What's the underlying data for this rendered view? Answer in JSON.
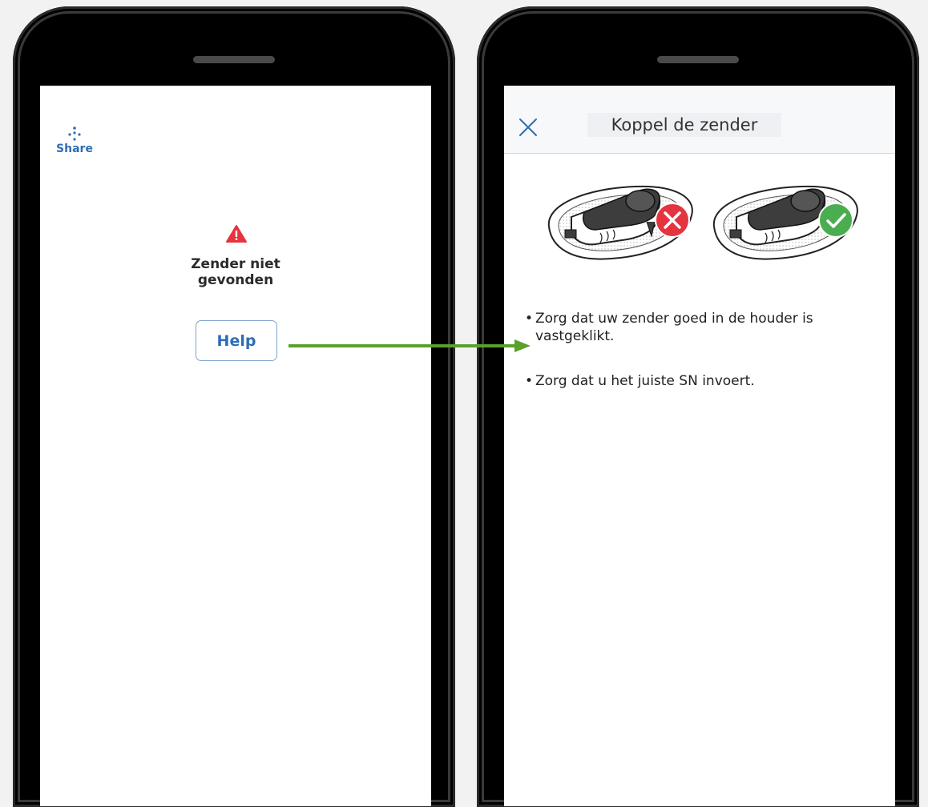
{
  "left_screen": {
    "share_label": "Share",
    "error_title": "Zender niet gevonden",
    "help_label": "Help"
  },
  "right_screen": {
    "header_title": "Koppel de zender",
    "bullets": [
      "Zorg dat uw zender goed in de houder is vastgeklikt.",
      "Zorg dat u het juiste SN invoert."
    ],
    "bullet_char": "•"
  },
  "icons": [
    "share-icon",
    "warning-icon",
    "close-icon",
    "incorrect-icon",
    "correct-icon",
    "arrow-right-icon"
  ],
  "colors": {
    "accent": "#2f6db5",
    "warning": "#e5333f",
    "incorrect": "#e5333f",
    "correct": "#4aad4f",
    "arrow": "#5aa02c"
  }
}
